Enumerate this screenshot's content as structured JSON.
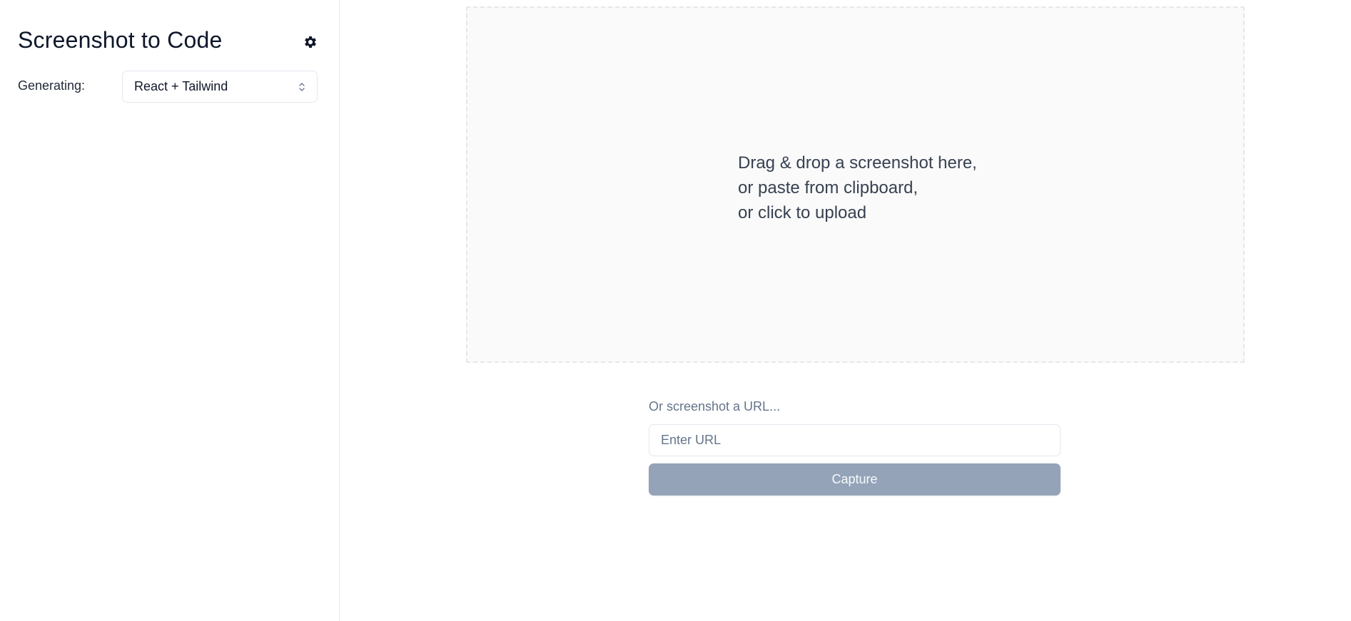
{
  "sidebar": {
    "title": "Screenshot to Code",
    "settings_icon": "gear-icon",
    "generating_label": "Generating:",
    "stack_select": {
      "value": "React + Tailwind",
      "icon": "chevron-up-down-icon"
    }
  },
  "main": {
    "dropzone": {
      "lines": [
        "Drag & drop a screenshot here,",
        "or paste from clipboard,",
        "or click to upload"
      ]
    },
    "url_section": {
      "label": "Or screenshot a URL...",
      "input_placeholder": "Enter URL",
      "input_value": "",
      "capture_label": "Capture"
    }
  },
  "colors": {
    "capture_button": "#94a3b8",
    "dropzone_bg": "#fafafa",
    "border": "#e2e8f0"
  }
}
